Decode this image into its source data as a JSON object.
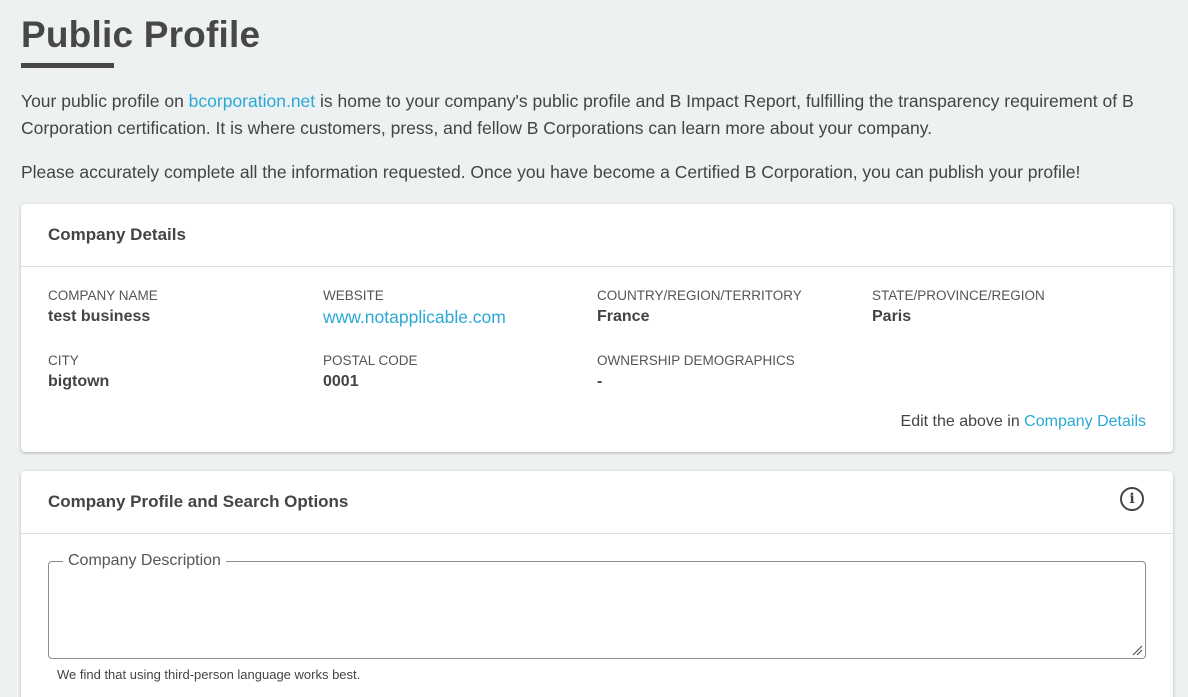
{
  "page": {
    "title": "Public Profile",
    "intro_before_link": "Your public profile on ",
    "intro_link": "bcorporation.net",
    "intro_after_link": " is home to your company's public profile and B Impact Report, fulfilling the transparency requirement of B Corporation certification. It is where customers, press, and fellow B Corporations can learn more about your company.",
    "intro2": "Please accurately complete all the information requested. Once you have become a Certified B Corporation, you can publish your profile!"
  },
  "company_details": {
    "header": "Company Details",
    "fields": {
      "company_name": {
        "label": "COMPANY NAME",
        "value": "test business"
      },
      "website": {
        "label": "WEBSITE",
        "value": "www.notapplicable.com"
      },
      "country": {
        "label": "COUNTRY/REGION/TERRITORY",
        "value": "France"
      },
      "state": {
        "label": "STATE/PROVINCE/REGION",
        "value": "Paris"
      },
      "city": {
        "label": "CITY",
        "value": "bigtown"
      },
      "postal_code": {
        "label": "POSTAL CODE",
        "value": "0001"
      },
      "ownership": {
        "label": "OWNERSHIP DEMOGRAPHICS",
        "value": "-"
      }
    },
    "edit_prefix": "Edit the above in ",
    "edit_link": "Company Details"
  },
  "profile_options": {
    "header": "Company Profile and Search Options",
    "info_icon": "info-icon",
    "description_legend": "Company Description",
    "description_value": "",
    "helper": "We find that using third-person language works best."
  },
  "colors": {
    "link": "#2ba9d6",
    "background": "#eef1f2",
    "text": "#444444"
  }
}
